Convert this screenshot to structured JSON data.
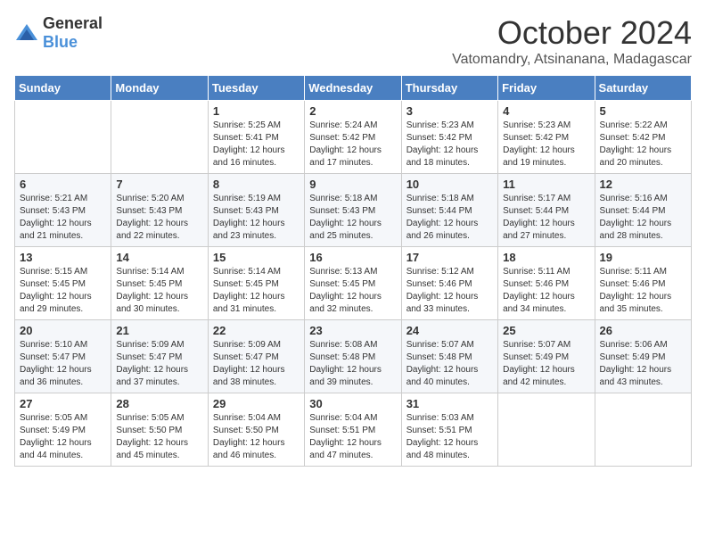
{
  "logo": {
    "general": "General",
    "blue": "Blue"
  },
  "title": "October 2024",
  "location": "Vatomandry, Atsinanana, Madagascar",
  "weekdays": [
    "Sunday",
    "Monday",
    "Tuesday",
    "Wednesday",
    "Thursday",
    "Friday",
    "Saturday"
  ],
  "weeks": [
    [
      {
        "day": "",
        "sunrise": "",
        "sunset": "",
        "daylight": ""
      },
      {
        "day": "",
        "sunrise": "",
        "sunset": "",
        "daylight": ""
      },
      {
        "day": "1",
        "sunrise": "Sunrise: 5:25 AM",
        "sunset": "Sunset: 5:41 PM",
        "daylight": "Daylight: 12 hours and 16 minutes."
      },
      {
        "day": "2",
        "sunrise": "Sunrise: 5:24 AM",
        "sunset": "Sunset: 5:42 PM",
        "daylight": "Daylight: 12 hours and 17 minutes."
      },
      {
        "day": "3",
        "sunrise": "Sunrise: 5:23 AM",
        "sunset": "Sunset: 5:42 PM",
        "daylight": "Daylight: 12 hours and 18 minutes."
      },
      {
        "day": "4",
        "sunrise": "Sunrise: 5:23 AM",
        "sunset": "Sunset: 5:42 PM",
        "daylight": "Daylight: 12 hours and 19 minutes."
      },
      {
        "day": "5",
        "sunrise": "Sunrise: 5:22 AM",
        "sunset": "Sunset: 5:42 PM",
        "daylight": "Daylight: 12 hours and 20 minutes."
      }
    ],
    [
      {
        "day": "6",
        "sunrise": "Sunrise: 5:21 AM",
        "sunset": "Sunset: 5:43 PM",
        "daylight": "Daylight: 12 hours and 21 minutes."
      },
      {
        "day": "7",
        "sunrise": "Sunrise: 5:20 AM",
        "sunset": "Sunset: 5:43 PM",
        "daylight": "Daylight: 12 hours and 22 minutes."
      },
      {
        "day": "8",
        "sunrise": "Sunrise: 5:19 AM",
        "sunset": "Sunset: 5:43 PM",
        "daylight": "Daylight: 12 hours and 23 minutes."
      },
      {
        "day": "9",
        "sunrise": "Sunrise: 5:18 AM",
        "sunset": "Sunset: 5:43 PM",
        "daylight": "Daylight: 12 hours and 25 minutes."
      },
      {
        "day": "10",
        "sunrise": "Sunrise: 5:18 AM",
        "sunset": "Sunset: 5:44 PM",
        "daylight": "Daylight: 12 hours and 26 minutes."
      },
      {
        "day": "11",
        "sunrise": "Sunrise: 5:17 AM",
        "sunset": "Sunset: 5:44 PM",
        "daylight": "Daylight: 12 hours and 27 minutes."
      },
      {
        "day": "12",
        "sunrise": "Sunrise: 5:16 AM",
        "sunset": "Sunset: 5:44 PM",
        "daylight": "Daylight: 12 hours and 28 minutes."
      }
    ],
    [
      {
        "day": "13",
        "sunrise": "Sunrise: 5:15 AM",
        "sunset": "Sunset: 5:45 PM",
        "daylight": "Daylight: 12 hours and 29 minutes."
      },
      {
        "day": "14",
        "sunrise": "Sunrise: 5:14 AM",
        "sunset": "Sunset: 5:45 PM",
        "daylight": "Daylight: 12 hours and 30 minutes."
      },
      {
        "day": "15",
        "sunrise": "Sunrise: 5:14 AM",
        "sunset": "Sunset: 5:45 PM",
        "daylight": "Daylight: 12 hours and 31 minutes."
      },
      {
        "day": "16",
        "sunrise": "Sunrise: 5:13 AM",
        "sunset": "Sunset: 5:45 PM",
        "daylight": "Daylight: 12 hours and 32 minutes."
      },
      {
        "day": "17",
        "sunrise": "Sunrise: 5:12 AM",
        "sunset": "Sunset: 5:46 PM",
        "daylight": "Daylight: 12 hours and 33 minutes."
      },
      {
        "day": "18",
        "sunrise": "Sunrise: 5:11 AM",
        "sunset": "Sunset: 5:46 PM",
        "daylight": "Daylight: 12 hours and 34 minutes."
      },
      {
        "day": "19",
        "sunrise": "Sunrise: 5:11 AM",
        "sunset": "Sunset: 5:46 PM",
        "daylight": "Daylight: 12 hours and 35 minutes."
      }
    ],
    [
      {
        "day": "20",
        "sunrise": "Sunrise: 5:10 AM",
        "sunset": "Sunset: 5:47 PM",
        "daylight": "Daylight: 12 hours and 36 minutes."
      },
      {
        "day": "21",
        "sunrise": "Sunrise: 5:09 AM",
        "sunset": "Sunset: 5:47 PM",
        "daylight": "Daylight: 12 hours and 37 minutes."
      },
      {
        "day": "22",
        "sunrise": "Sunrise: 5:09 AM",
        "sunset": "Sunset: 5:47 PM",
        "daylight": "Daylight: 12 hours and 38 minutes."
      },
      {
        "day": "23",
        "sunrise": "Sunrise: 5:08 AM",
        "sunset": "Sunset: 5:48 PM",
        "daylight": "Daylight: 12 hours and 39 minutes."
      },
      {
        "day": "24",
        "sunrise": "Sunrise: 5:07 AM",
        "sunset": "Sunset: 5:48 PM",
        "daylight": "Daylight: 12 hours and 40 minutes."
      },
      {
        "day": "25",
        "sunrise": "Sunrise: 5:07 AM",
        "sunset": "Sunset: 5:49 PM",
        "daylight": "Daylight: 12 hours and 42 minutes."
      },
      {
        "day": "26",
        "sunrise": "Sunrise: 5:06 AM",
        "sunset": "Sunset: 5:49 PM",
        "daylight": "Daylight: 12 hours and 43 minutes."
      }
    ],
    [
      {
        "day": "27",
        "sunrise": "Sunrise: 5:05 AM",
        "sunset": "Sunset: 5:49 PM",
        "daylight": "Daylight: 12 hours and 44 minutes."
      },
      {
        "day": "28",
        "sunrise": "Sunrise: 5:05 AM",
        "sunset": "Sunset: 5:50 PM",
        "daylight": "Daylight: 12 hours and 45 minutes."
      },
      {
        "day": "29",
        "sunrise": "Sunrise: 5:04 AM",
        "sunset": "Sunset: 5:50 PM",
        "daylight": "Daylight: 12 hours and 46 minutes."
      },
      {
        "day": "30",
        "sunrise": "Sunrise: 5:04 AM",
        "sunset": "Sunset: 5:51 PM",
        "daylight": "Daylight: 12 hours and 47 minutes."
      },
      {
        "day": "31",
        "sunrise": "Sunrise: 5:03 AM",
        "sunset": "Sunset: 5:51 PM",
        "daylight": "Daylight: 12 hours and 48 minutes."
      },
      {
        "day": "",
        "sunrise": "",
        "sunset": "",
        "daylight": ""
      },
      {
        "day": "",
        "sunrise": "",
        "sunset": "",
        "daylight": ""
      }
    ]
  ]
}
